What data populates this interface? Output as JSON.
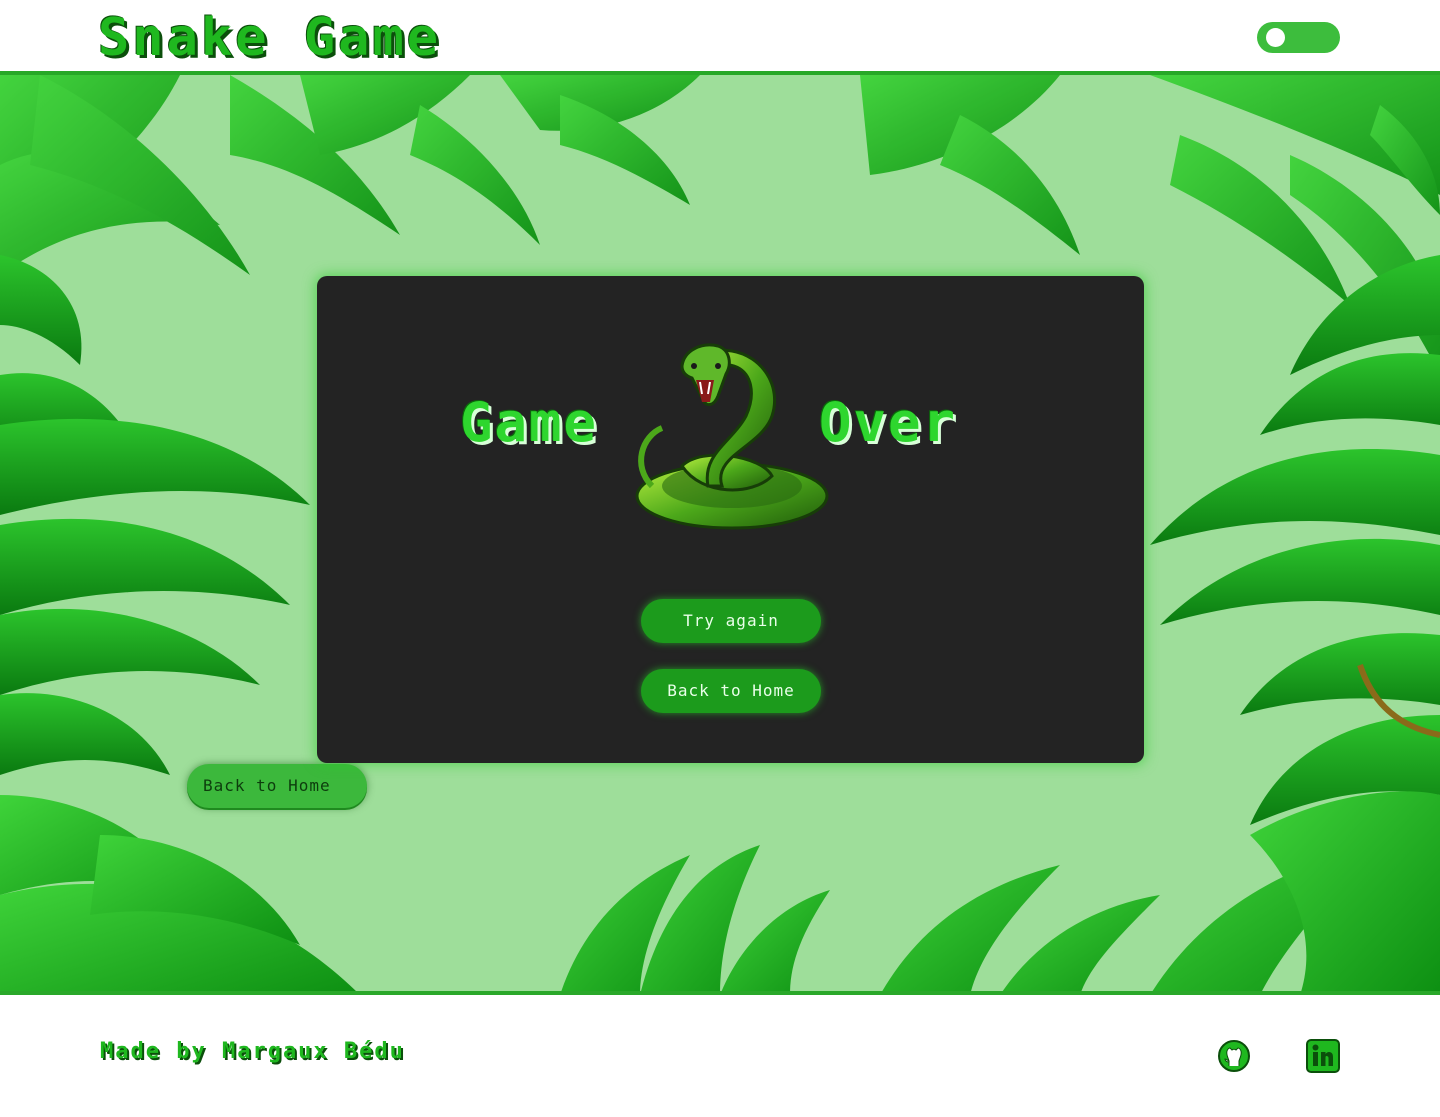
{
  "header": {
    "title": "Snake Game",
    "theme_toggle_icon": "toggle-switch"
  },
  "background": {
    "back_home_label": "Back to Home"
  },
  "modal": {
    "word_left": "Game",
    "word_right": "Over",
    "snake_icon": "green-snake-image",
    "try_again_label": "Try again",
    "back_home_label": "Back to Home"
  },
  "footer": {
    "credit": "Made by Margaux Bédu",
    "github_icon": "github-icon",
    "linkedin_icon": "linkedin-icon"
  },
  "colors": {
    "accent_green": "#1fb81f",
    "dark_green": "#0b4f0b",
    "jungle_bg": "#9ede9a",
    "modal_bg": "#232323",
    "button_green": "#1c9b1c"
  }
}
